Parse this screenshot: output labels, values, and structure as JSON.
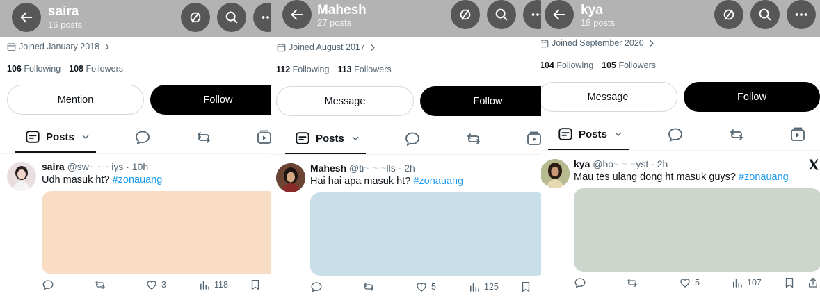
{
  "panels": [
    {
      "name": "saira",
      "posts": "16 posts",
      "joined": "Joined January 2018",
      "following_count": "106",
      "following_label": "Following",
      "followers_count": "108",
      "followers_label": "Followers",
      "left_button": "Mention",
      "follow_button": "Follow",
      "tab_label": "Posts",
      "post": {
        "author": "saira",
        "handle": "@sw",
        "handle_obscured_tail": "iys",
        "time": "· 10h",
        "text": "Udh masuk ht? ",
        "hashtag": "#zonauang",
        "media_color": "#f9dcc4",
        "likes": "3",
        "views": "118"
      },
      "avatar_bg": "#e9dfe0"
    },
    {
      "name": "Mahesh",
      "posts": "27 posts",
      "joined": "Joined August 2017",
      "following_count": "112",
      "following_label": "Following",
      "followers_count": "113",
      "followers_label": "Followers",
      "left_button": "Message",
      "follow_button": "Follow",
      "tab_label": "Posts",
      "post": {
        "author": "Mahesh",
        "handle": "@ti",
        "handle_obscured_tail": "lls",
        "time": "· 2h",
        "text": "Hai hai apa masuk ht? ",
        "hashtag": "#zonauang",
        "media_color": "#c8dfe9",
        "likes": "5",
        "views": "125"
      },
      "avatar_bg": "#5a3b2e"
    },
    {
      "name": "kya",
      "posts": "18 posts",
      "joined": "Joined September 2020",
      "following_count": "104",
      "following_label": "Following",
      "followers_count": "105",
      "followers_label": "Followers",
      "left_button": "Message",
      "follow_button": "Follow",
      "tab_label": "Posts",
      "post": {
        "author": "kya",
        "handle": "@ho",
        "handle_obscured_tail": "yst",
        "time": "· 2h",
        "text": "Mau tes ulang dong ht masuk guys? ",
        "hashtag": "#zonauang",
        "media_color": "#ccd6cd",
        "likes": "5",
        "views": "107"
      },
      "avatar_bg": "#9aa17a"
    }
  ],
  "colors": {
    "accent": "#1d9bf0",
    "header_bg": "#b3b3b3",
    "header_button": "#575757",
    "text_secondary": "#536471"
  },
  "icons": [
    "back-arrow-icon",
    "grok-icon",
    "search-icon",
    "more-icon",
    "calendar-icon",
    "chevron-right-icon",
    "posts-tab-icon",
    "chevron-down-icon",
    "reply-icon",
    "repost-icon",
    "video-icon",
    "like-icon",
    "views-icon",
    "bookmark-icon",
    "share-icon",
    "x-logo-icon"
  ]
}
